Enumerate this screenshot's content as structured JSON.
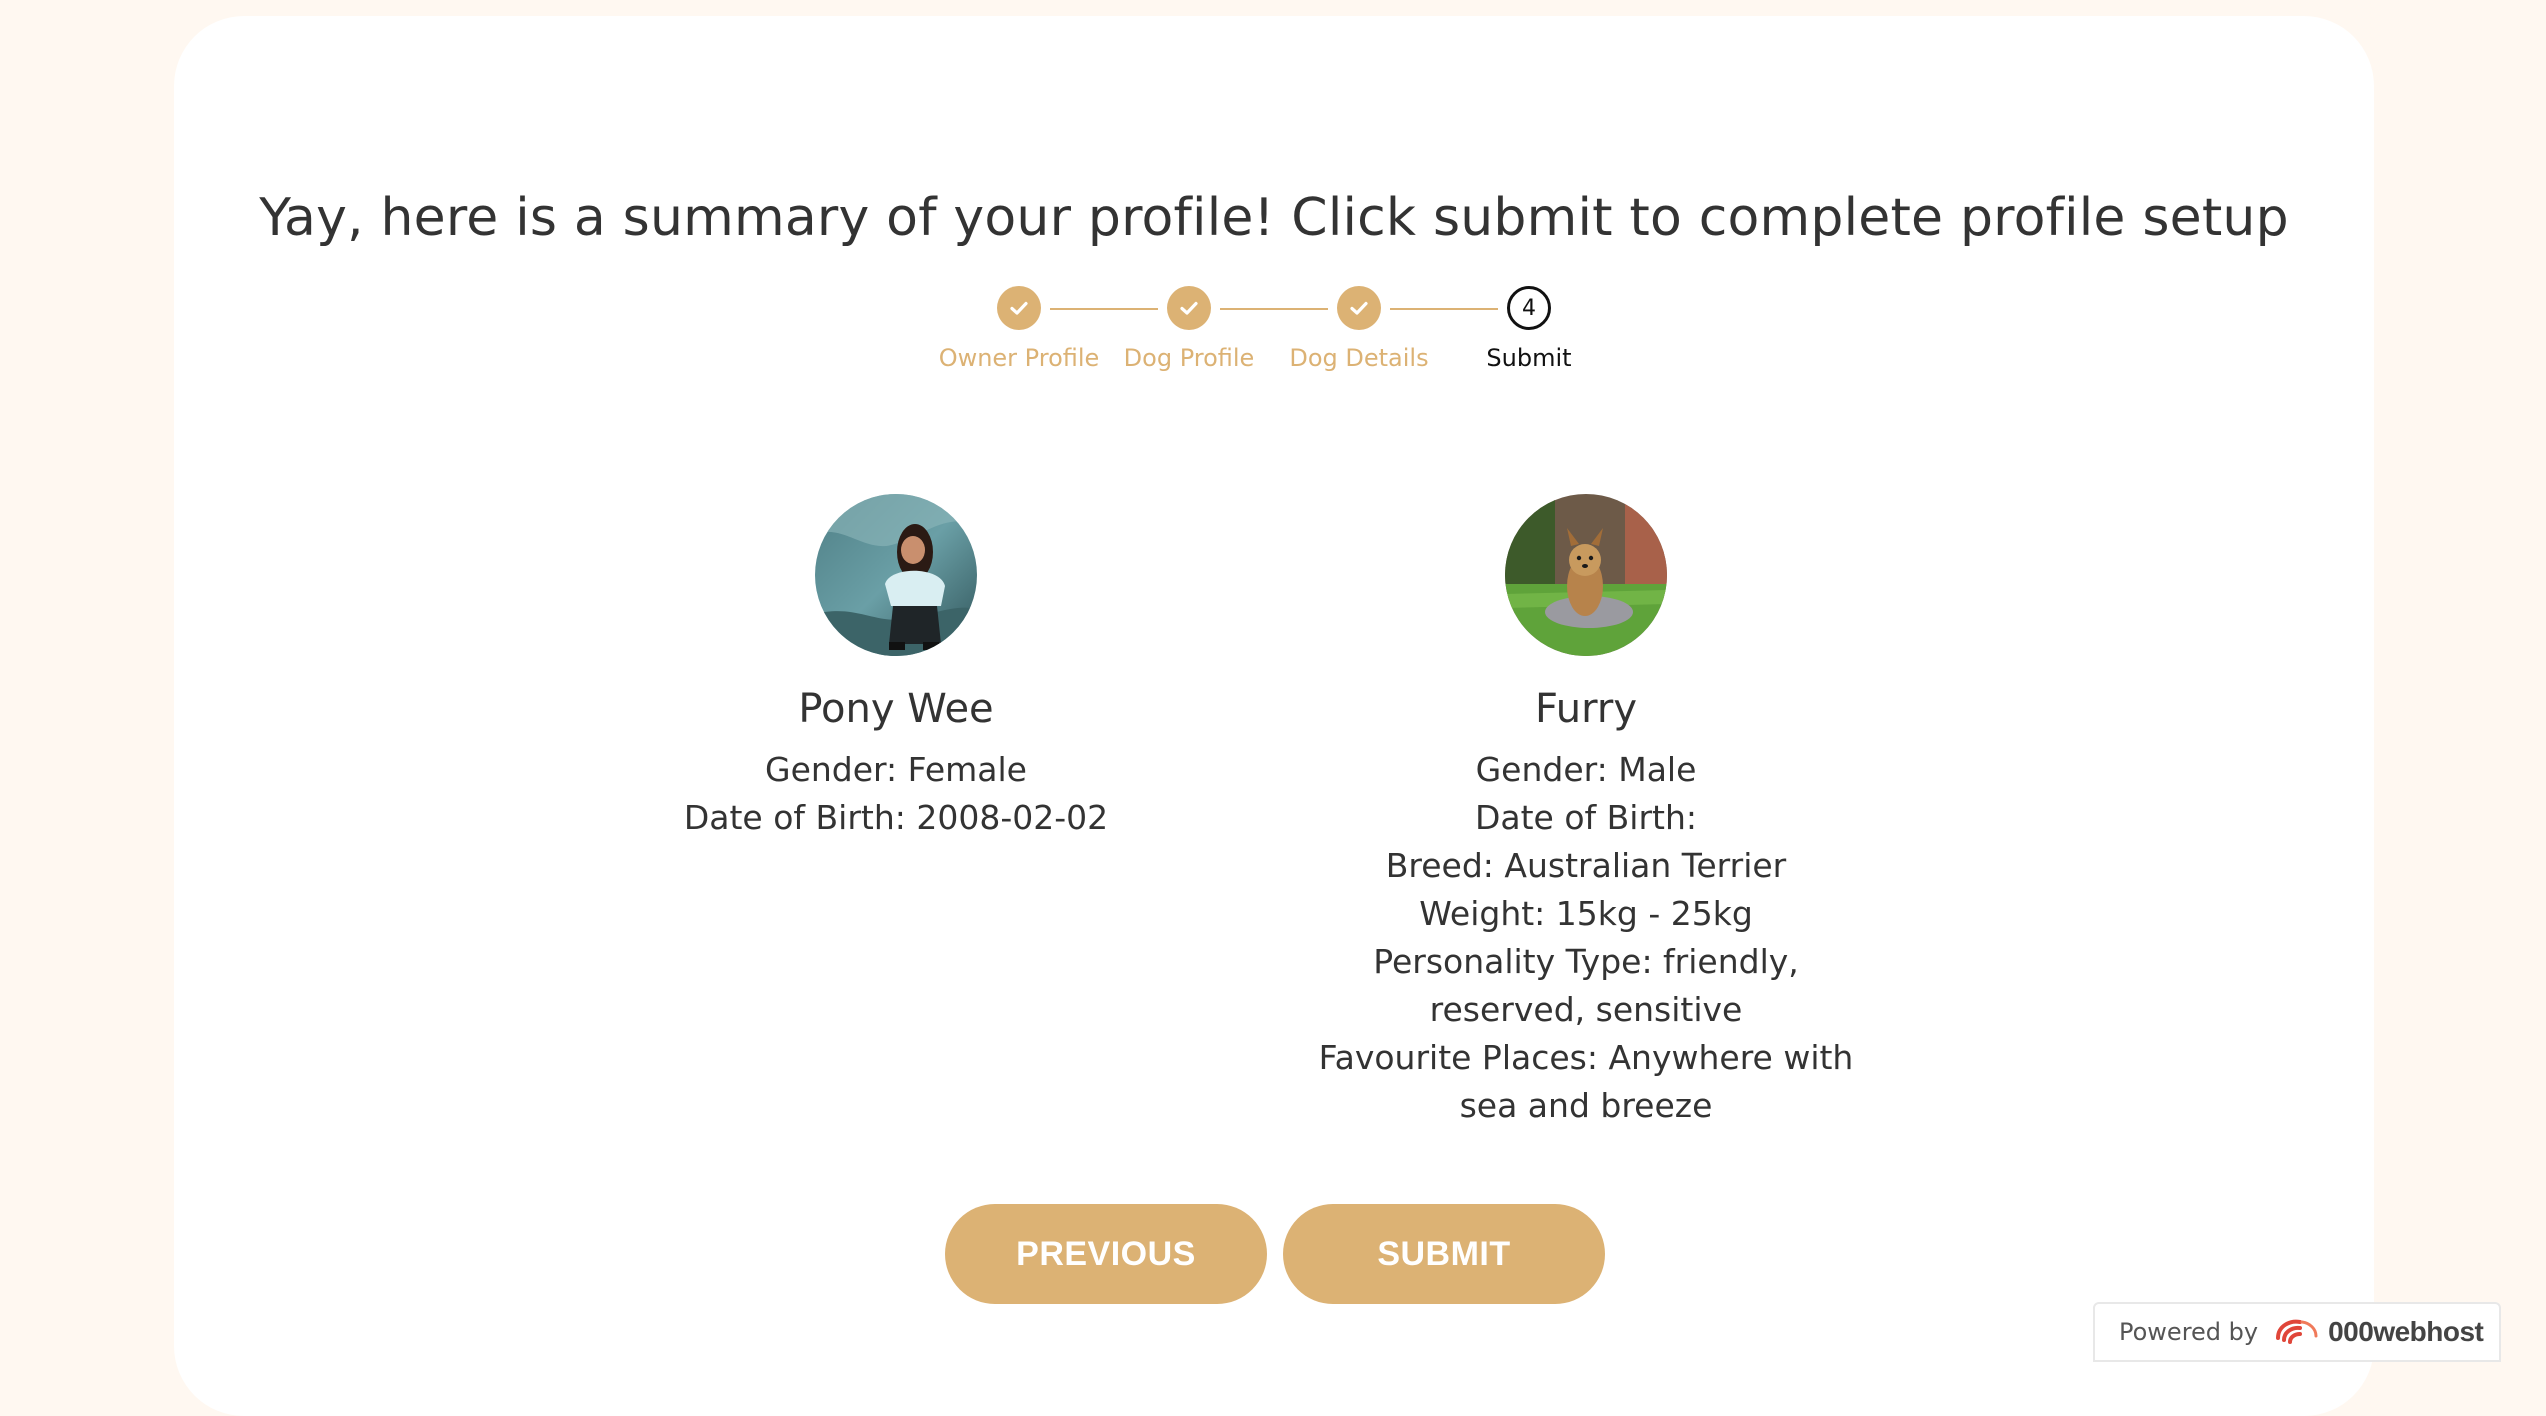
{
  "title": "Yay, here is a summary of your profile! Click submit to complete profile setup",
  "stepper": {
    "steps": [
      {
        "label": "Owner Profile",
        "state": "done"
      },
      {
        "label": "Dog Profile",
        "state": "done"
      },
      {
        "label": "Dog Details",
        "state": "done"
      },
      {
        "label": "Submit",
        "state": "current",
        "number": "4"
      }
    ]
  },
  "owner": {
    "name": "Pony Wee",
    "gender": "Gender: Female",
    "dob": "Date of Birth: 2008-02-02"
  },
  "dog": {
    "name": "Furry",
    "gender": "Gender: Male",
    "dob": "Date of Birth:",
    "breed": "Breed: Australian Terrier",
    "weight": "Weight: 15kg - 25kg",
    "personality_1": "Personality Type: friendly,",
    "personality_2": "reserved, sensitive",
    "places_1": "Favourite Places: Anywhere with",
    "places_2": "sea and breeze"
  },
  "buttons": {
    "previous": "PREVIOUS",
    "submit": "SUBMIT"
  },
  "badge": {
    "powered_by": "Powered by",
    "brand": "000webhost"
  },
  "colors": {
    "accent": "#dcb274",
    "page_bg": "#fff8f1",
    "card_bg": "#ffffff",
    "text": "#333333"
  }
}
